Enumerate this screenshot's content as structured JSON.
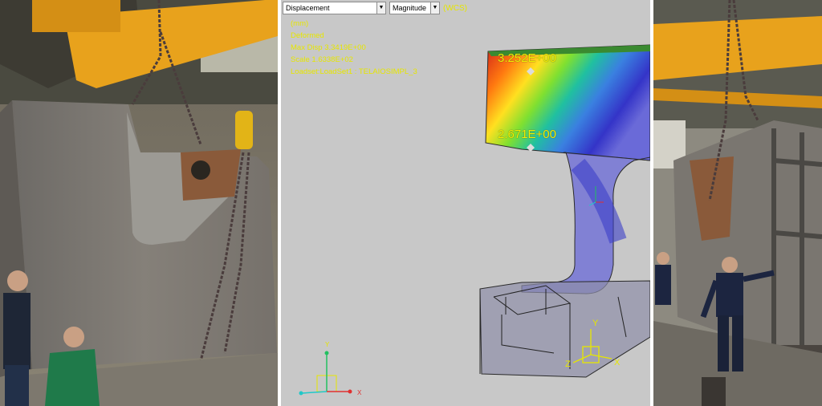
{
  "toolbar": {
    "result_dropdown": "Displacement",
    "component_dropdown": "Magnitude",
    "coordinate_system": "(WCS)"
  },
  "legend": {
    "units": "(mm)",
    "mode": "Deformed",
    "max_disp": "Max Disp  3.3419E+00",
    "scale": "Scale  1.6338E+02",
    "loadset": "Loadset:LoadSet1 :  TELAIOSIMPL_3"
  },
  "annotations": {
    "max_value": "3.252E+00",
    "second_value": "2.671E+00"
  },
  "triad_global": {
    "y": "Y",
    "x": "X"
  },
  "triad_local": {
    "y": "Y",
    "z": "Z",
    "x": "X"
  },
  "colors": {
    "fea_background": "#c8c8c8",
    "label_yellow": "#e6e600",
    "contour_red": "#e0201c",
    "contour_blue": "#3a3ad0"
  }
}
